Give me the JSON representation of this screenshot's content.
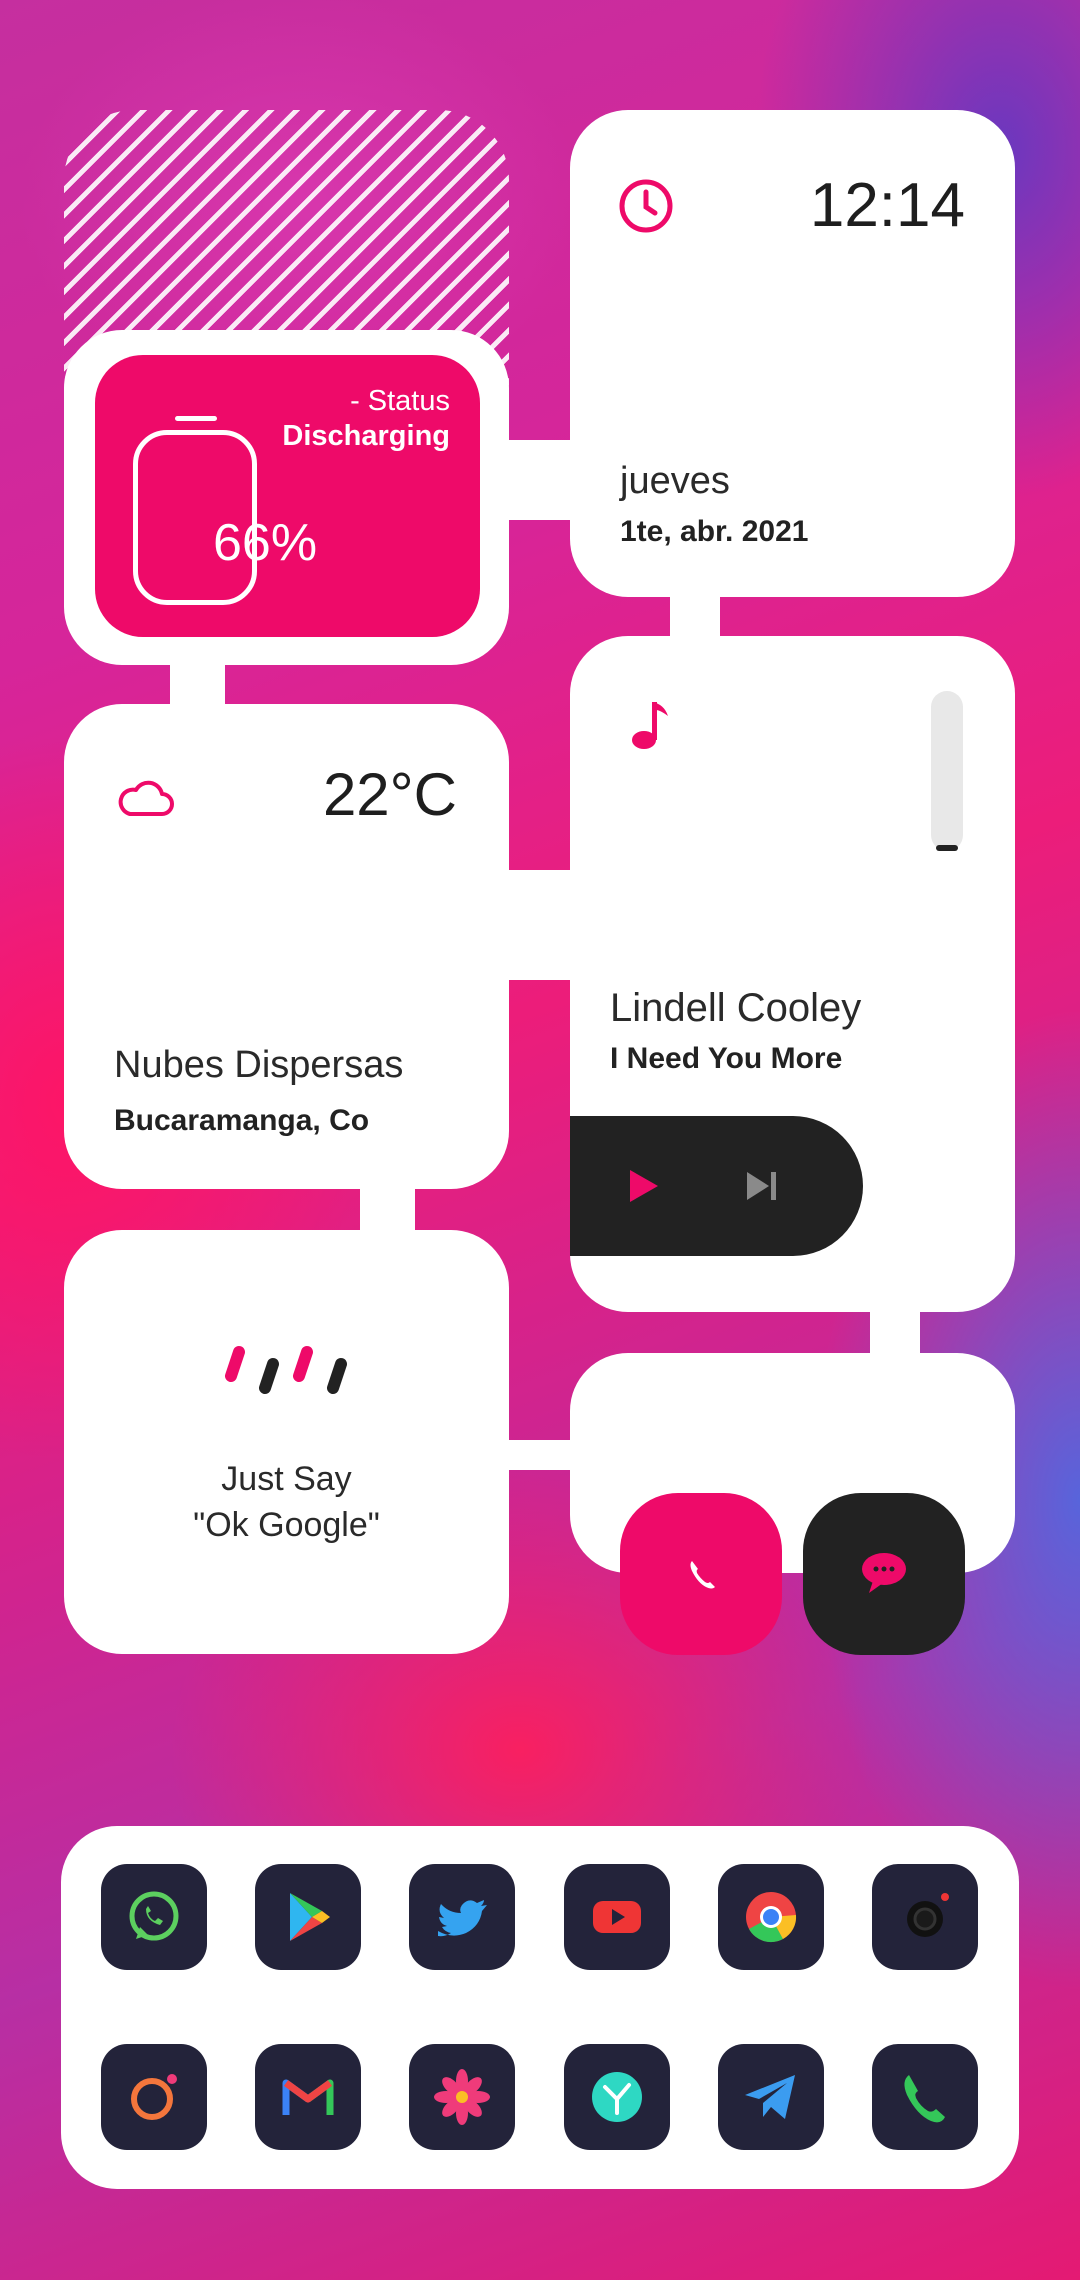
{
  "battery": {
    "status_label": "- Status",
    "status_value": "Discharging",
    "percent": "66%"
  },
  "clock": {
    "time": "12:14",
    "day": "jueves",
    "date": "1te, abr. 2021"
  },
  "weather": {
    "temperature": "22°C",
    "description": "Nubes Dispersas",
    "location": "Bucaramanga, Co"
  },
  "music": {
    "artist": "Lindell Cooley",
    "song": "I Need You More"
  },
  "google": {
    "line1": "Just Say",
    "line2": "\"Ok Google\""
  },
  "colors": {
    "accent": "#ee0a69",
    "dark": "#222222",
    "icon_bg": "#23233a"
  },
  "dock": {
    "row1": [
      "whatsapp-icon",
      "play-store-icon",
      "twitter-icon",
      "youtube-icon",
      "chrome-icon",
      "camera-icon"
    ],
    "row2": [
      "camera-lens-icon",
      "gmail-icon",
      "gallery-flower-icon",
      "clock-app-icon",
      "telegram-icon",
      "phone-icon"
    ]
  }
}
